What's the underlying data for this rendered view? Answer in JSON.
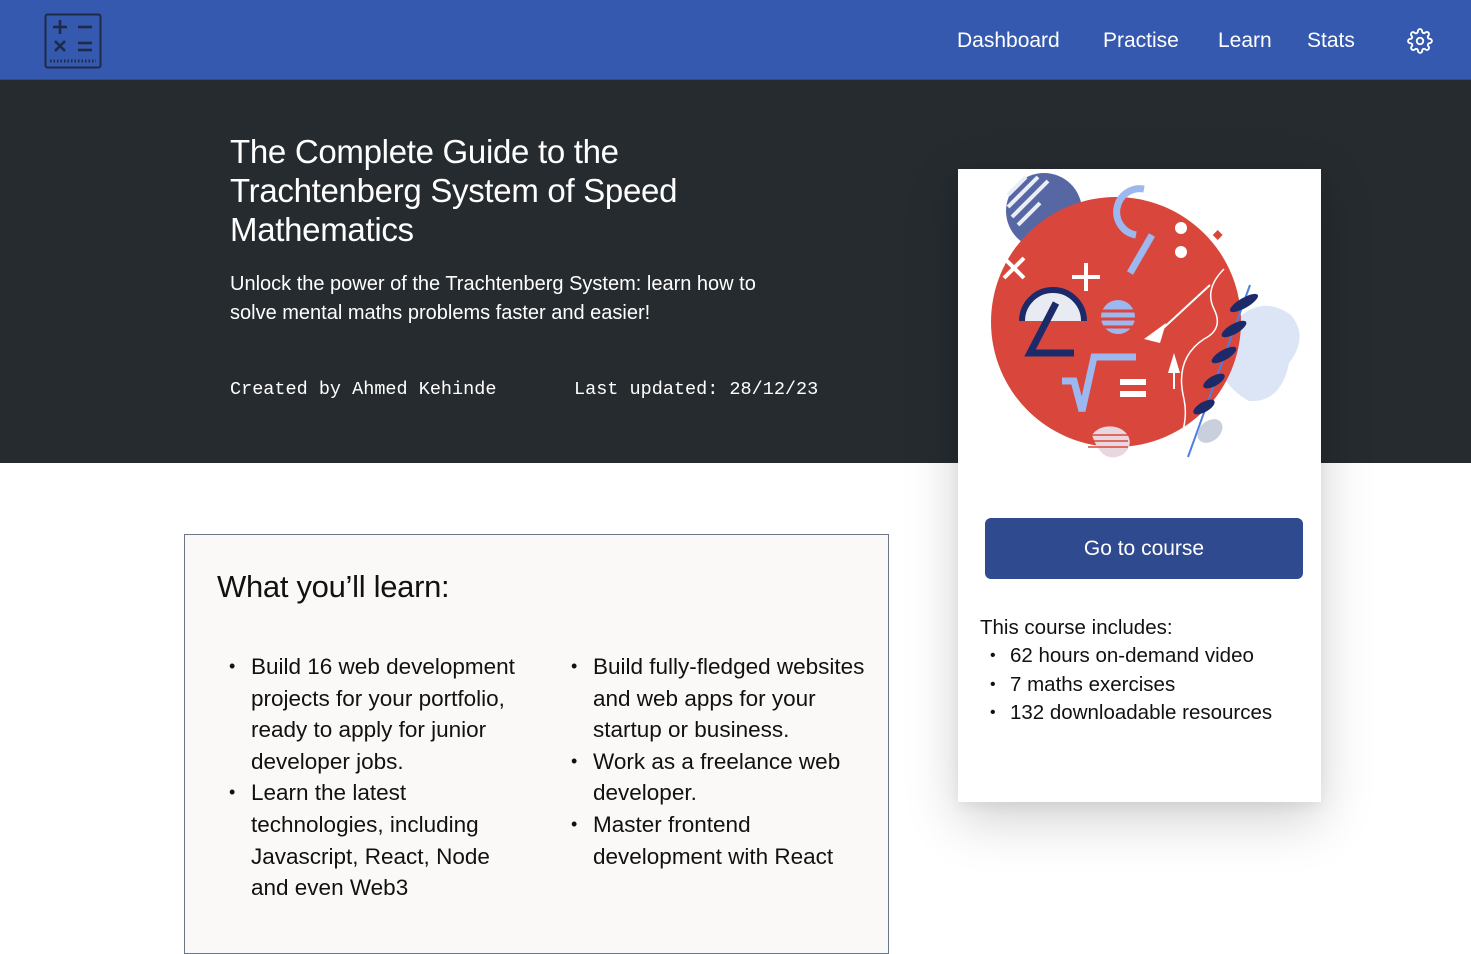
{
  "nav": {
    "logo_icon": "calculator-icon",
    "items": [
      {
        "label": "Dashboard"
      },
      {
        "label": "Practise"
      },
      {
        "label": "Learn"
      },
      {
        "label": "Stats"
      }
    ],
    "settings_icon": "gear-icon"
  },
  "hero": {
    "title": "The Complete Guide to the Trachtenberg System of Speed Mathematics",
    "subtitle": "Unlock the power of the Trachtenberg System: learn how to solve mental maths problems faster and easier!",
    "created_by": "Created by Ahmed Kehinde",
    "last_updated": "Last updated: 28/12/23"
  },
  "learn": {
    "title": "What you’ll learn:",
    "left_items": [
      "Build 16 web development projects for your portfolio, ready to apply for junior developer jobs.",
      "Learn the latest technologies, including Javascript, React, Node and even Web3"
    ],
    "right_items": [
      "Build fully-fledged websites and web apps for your startup or business.",
      "Work as a freelance web developer.",
      "Master frontend development with React"
    ]
  },
  "card": {
    "illustration": "math-symbols-illustration",
    "cta_label": "Go to course",
    "includes_title": "This course includes:",
    "includes": [
      "62 hours on-demand video",
      "7 maths exercises",
      "132 downloadable resources"
    ]
  },
  "colors": {
    "nav_bg": "#3559af",
    "hero_bg": "#252b2f",
    "cta_bg": "#2f4a8f",
    "accent_red": "#d9463c"
  }
}
